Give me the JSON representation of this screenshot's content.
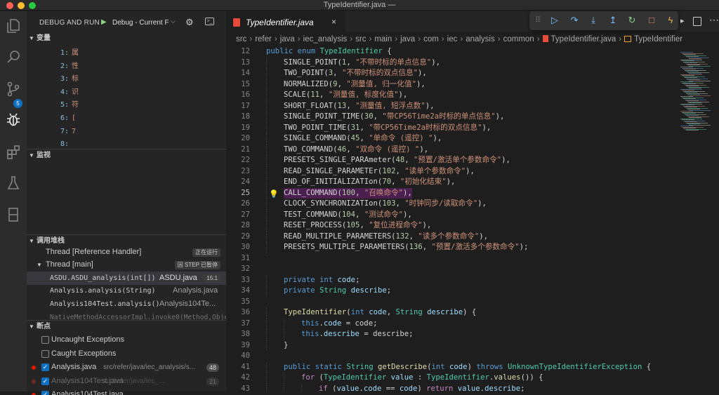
{
  "window": {
    "title": "TypeIdentifier.java —"
  },
  "activity": {
    "icons": [
      "files-icon",
      "search-icon",
      "source-control-icon",
      "debug-icon",
      "extensions-icon",
      "testing-icon",
      "book-icon"
    ],
    "scm_badge": "5"
  },
  "sidebar": {
    "title": "DEBUG AND RUN",
    "config": "Debug - Current F",
    "variables": {
      "title": "变量",
      "rows": [
        {
          "k": "1:",
          "v": "属"
        },
        {
          "k": "2:",
          "v": "性"
        },
        {
          "k": "3:",
          "v": "标"
        },
        {
          "k": "4:",
          "v": "识"
        },
        {
          "k": "5:",
          "v": "符"
        },
        {
          "k": "6:",
          "v": "["
        },
        {
          "k": "7:",
          "v": "7"
        },
        {
          "k": "8:",
          "v": ""
        }
      ]
    },
    "watch": {
      "title": "监视"
    },
    "callstack": {
      "title": "调用堆栈",
      "rows": [
        {
          "name": "Thread [Reference Handler]",
          "tag": "正在运行"
        },
        {
          "name": "Thread [main]",
          "tag": "因 STEP 已暂停"
        },
        {
          "name": "ASDU.ASDU_analysis(int[])",
          "file": "ASDU.java",
          "tag": "15:1"
        },
        {
          "name": "Analysis.analysis(String)",
          "file": "Analysis.java"
        },
        {
          "name": "Analysis104Test.analysis()",
          "file": "Analysis104Te..."
        },
        {
          "name": "NativeMethodAccessorImpl.invoke0(Method,Obje",
          "file": ""
        }
      ]
    },
    "breakpoints": {
      "title": "断点",
      "rows": [
        {
          "label": "Uncaught Exceptions",
          "checked": false
        },
        {
          "label": "Caught Exceptions",
          "checked": false
        },
        {
          "label": "Analysis.java",
          "path": "src/refer/java/iec_analysis/s...",
          "count": "48",
          "checked": true
        },
        {
          "label": "Analysis104Test.java",
          "path": "src/refer/java/iec_...",
          "count": "21",
          "checked": true
        },
        {
          "label": "Analysis104Test.java",
          "path": "",
          "count": "",
          "checked": true
        }
      ]
    }
  },
  "editor": {
    "tab": "TypeIdentifier.java",
    "close": "×",
    "breadcrumb": [
      "src",
      "refer",
      "java",
      "iec_analysis",
      "src",
      "main",
      "java",
      "com",
      "iec",
      "analysis",
      "common",
      "TypeIdentifier.java",
      "TypeIdentifier"
    ],
    "current_line": "25",
    "lines": [
      {
        "n": "12",
        "t": [
          [
            "kw",
            "public "
          ],
          [
            "kw",
            "enum "
          ],
          [
            "ty",
            "TypeIdentifier"
          ],
          [
            "en",
            " {"
          ]
        ]
      },
      {
        "n": "13",
        "i": 1,
        "t": [
          [
            "en",
            "SINGLE_POINT("
          ],
          [
            "nu",
            "1"
          ],
          [
            "en",
            ", "
          ],
          [
            "st",
            "\"不带时标的单点信息\""
          ],
          [
            "en",
            "),"
          ]
        ]
      },
      {
        "n": "14",
        "i": 1,
        "t": [
          [
            "en",
            "TWO_POINT("
          ],
          [
            "nu",
            "3"
          ],
          [
            "en",
            ", "
          ],
          [
            "st",
            "\"不带时标的双点信息\""
          ],
          [
            "en",
            "),"
          ]
        ]
      },
      {
        "n": "15",
        "i": 1,
        "t": [
          [
            "en",
            "NORMALIZED("
          ],
          [
            "nu",
            "9"
          ],
          [
            "en",
            ", "
          ],
          [
            "st",
            "\"测量值, 归一化值\""
          ],
          [
            "en",
            "),"
          ]
        ]
      },
      {
        "n": "16",
        "i": 1,
        "t": [
          [
            "en",
            "SCALE("
          ],
          [
            "nu",
            "11"
          ],
          [
            "en",
            ", "
          ],
          [
            "st",
            "\"测量值, 标度化值\""
          ],
          [
            "en",
            "),"
          ]
        ]
      },
      {
        "n": "17",
        "i": 1,
        "t": [
          [
            "en",
            "SHORT_FLOAT("
          ],
          [
            "nu",
            "13"
          ],
          [
            "en",
            ", "
          ],
          [
            "st",
            "\"测量值, 短浮点数\""
          ],
          [
            "en",
            "),"
          ]
        ]
      },
      {
        "n": "18",
        "i": 1,
        "t": [
          [
            "en",
            "SINGLE_POINT_TIME("
          ],
          [
            "nu",
            "30"
          ],
          [
            "en",
            ", "
          ],
          [
            "st",
            "\"带CP56Time2a时标的单点信息\""
          ],
          [
            "en",
            "),"
          ]
        ]
      },
      {
        "n": "19",
        "i": 1,
        "t": [
          [
            "en",
            "TWO_POINT_TIME("
          ],
          [
            "nu",
            "31"
          ],
          [
            "en",
            ", "
          ],
          [
            "st",
            "\"带CP56Time2a时标的双点信息\""
          ],
          [
            "en",
            "),"
          ]
        ]
      },
      {
        "n": "20",
        "i": 1,
        "t": [
          [
            "en",
            "SINGLE_COMMAND("
          ],
          [
            "nu",
            "45"
          ],
          [
            "en",
            ", "
          ],
          [
            "st",
            "\"单命令 (遥控) \""
          ],
          [
            "en",
            "),"
          ]
        ]
      },
      {
        "n": "21",
        "i": 1,
        "t": [
          [
            "en",
            "TWO_COMMAND("
          ],
          [
            "nu",
            "46"
          ],
          [
            "en",
            ", "
          ],
          [
            "st",
            "\"双命令 (遥控) \""
          ],
          [
            "en",
            "),"
          ]
        ]
      },
      {
        "n": "22",
        "i": 1,
        "t": [
          [
            "en",
            "PRESETS_SINGLE_PARAmeter("
          ],
          [
            "nu",
            "48"
          ],
          [
            "en",
            ", "
          ],
          [
            "st",
            "\"预置/激活单个参数命令\""
          ],
          [
            "en",
            "),"
          ]
        ]
      },
      {
        "n": "23",
        "i": 1,
        "t": [
          [
            "en",
            "READ_SINGLE_PARAMETEr("
          ],
          [
            "nu",
            "102"
          ],
          [
            "en",
            ", "
          ],
          [
            "st",
            "\"读单个参数命令\""
          ],
          [
            "en",
            "),"
          ]
        ]
      },
      {
        "n": "24",
        "i": 1,
        "t": [
          [
            "en",
            "END_OF_INITIALIZATIon("
          ],
          [
            "nu",
            "70"
          ],
          [
            "en",
            ", "
          ],
          [
            "st",
            "\"初始化结束\""
          ],
          [
            "en",
            "),"
          ]
        ]
      },
      {
        "n": "25",
        "i": 1,
        "hl": true,
        "t": [
          [
            "en",
            "CALL_COMMAND("
          ],
          [
            "nu",
            "100"
          ],
          [
            "en",
            ", "
          ],
          [
            "st",
            "\"召唤命令\""
          ],
          [
            "en",
            "),"
          ]
        ]
      },
      {
        "n": "26",
        "i": 1,
        "t": [
          [
            "en",
            "CLOCK_SYNCHRONIZATIon("
          ],
          [
            "nu",
            "103"
          ],
          [
            "en",
            ", "
          ],
          [
            "st",
            "\"时钟同步/读取命令\""
          ],
          [
            "en",
            "),"
          ]
        ]
      },
      {
        "n": "27",
        "i": 1,
        "t": [
          [
            "en",
            "TEST_COMMAND("
          ],
          [
            "nu",
            "104"
          ],
          [
            "en",
            ", "
          ],
          [
            "st",
            "\"测试命令\""
          ],
          [
            "en",
            "),"
          ]
        ]
      },
      {
        "n": "28",
        "i": 1,
        "t": [
          [
            "en",
            "RESET_PROCESS("
          ],
          [
            "nu",
            "105"
          ],
          [
            "en",
            ", "
          ],
          [
            "st",
            "\"复位进程命令\""
          ],
          [
            "en",
            "),"
          ]
        ]
      },
      {
        "n": "29",
        "i": 1,
        "t": [
          [
            "en",
            "READ_MULTIPLE_PARAMETERS("
          ],
          [
            "nu",
            "132"
          ],
          [
            "en",
            ", "
          ],
          [
            "st",
            "\"读多个参数命令\""
          ],
          [
            "en",
            "),"
          ]
        ]
      },
      {
        "n": "30",
        "i": 1,
        "t": [
          [
            "en",
            "PRESETS_MULTIPLE_PARAMETERS("
          ],
          [
            "nu",
            "136"
          ],
          [
            "en",
            ", "
          ],
          [
            "st",
            "\"预置/激活多个参数命令\""
          ],
          [
            "en",
            ");"
          ]
        ]
      },
      {
        "n": "31",
        "t": []
      },
      {
        "n": "32",
        "t": []
      },
      {
        "n": "33",
        "i": 1,
        "t": [
          [
            "kw",
            "private "
          ],
          [
            "kw",
            "int "
          ],
          [
            "va",
            "code"
          ],
          [
            "en",
            ";"
          ]
        ]
      },
      {
        "n": "34",
        "i": 1,
        "t": [
          [
            "kw",
            "private "
          ],
          [
            "ty",
            "String "
          ],
          [
            "va",
            "describe"
          ],
          [
            "en",
            ";"
          ]
        ]
      },
      {
        "n": "35",
        "t": []
      },
      {
        "n": "36",
        "i": 1,
        "t": [
          [
            "fn",
            "TypeIdentifier"
          ],
          [
            "en",
            "("
          ],
          [
            "kw",
            "int "
          ],
          [
            "va",
            "code"
          ],
          [
            "en",
            ", "
          ],
          [
            "ty",
            "String "
          ],
          [
            "va",
            "describe"
          ],
          [
            "en",
            ") {"
          ]
        ]
      },
      {
        "n": "37",
        "i": 2,
        "t": [
          [
            "kw",
            "this"
          ],
          [
            "en",
            "."
          ],
          [
            "va",
            "code"
          ],
          [
            "en",
            " = code;"
          ]
        ]
      },
      {
        "n": "38",
        "i": 2,
        "t": [
          [
            "kw",
            "this"
          ],
          [
            "en",
            "."
          ],
          [
            "va",
            "describe"
          ],
          [
            "en",
            " = describe;"
          ]
        ]
      },
      {
        "n": "39",
        "i": 1,
        "t": [
          [
            "en",
            "}"
          ]
        ]
      },
      {
        "n": "40",
        "t": []
      },
      {
        "n": "41",
        "i": 1,
        "t": [
          [
            "kw",
            "public "
          ],
          [
            "kw",
            "static "
          ],
          [
            "ty",
            "String "
          ],
          [
            "fn",
            "getDescribe"
          ],
          [
            "en",
            "("
          ],
          [
            "kw",
            "int "
          ],
          [
            "va",
            "code"
          ],
          [
            "en",
            ") "
          ],
          [
            "kw",
            "throws "
          ],
          [
            "ty",
            "UnknownTypeIdentifierException"
          ],
          [
            "en",
            " {"
          ]
        ]
      },
      {
        "n": "42",
        "i": 2,
        "t": [
          [
            "ct",
            "for "
          ],
          [
            "en",
            "("
          ],
          [
            "ty",
            "TypeIdentifier "
          ],
          [
            "va",
            "value"
          ],
          [
            "en",
            " : "
          ],
          [
            "ty",
            "TypeIdentifier"
          ],
          [
            "en",
            "."
          ],
          [
            "fn",
            "values"
          ],
          [
            "en",
            "()) {"
          ]
        ]
      },
      {
        "n": "43",
        "i": 3,
        "t": [
          [
            "ct",
            "if "
          ],
          [
            "en",
            "("
          ],
          [
            "va",
            "value"
          ],
          [
            "en",
            "."
          ],
          [
            "va",
            "code"
          ],
          [
            "en",
            " == "
          ],
          [
            "va",
            "code"
          ],
          [
            "en",
            ") "
          ],
          [
            "ct",
            "return "
          ],
          [
            "va",
            "value"
          ],
          [
            "en",
            "."
          ],
          [
            "va",
            "describe"
          ],
          [
            "en",
            ";"
          ]
        ]
      }
    ]
  }
}
